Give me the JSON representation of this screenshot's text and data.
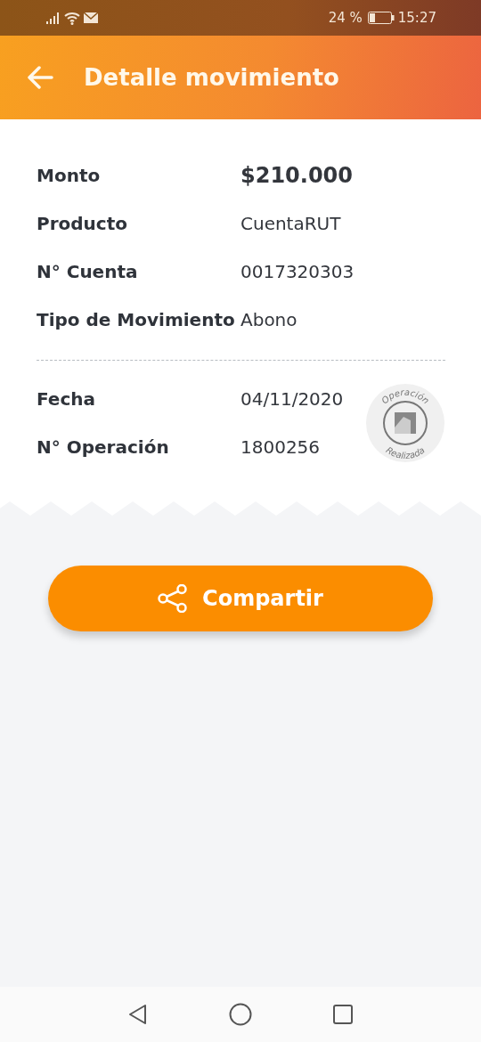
{
  "status_bar": {
    "battery": "24 %",
    "time": "15:27"
  },
  "header": {
    "title": "Detalle movimiento"
  },
  "details": [
    {
      "label": "Monto",
      "value": "$210.000",
      "kind": "amount"
    },
    {
      "label": "Producto",
      "value": "CuentaRUT",
      "kind": "plain"
    },
    {
      "label": "N° Cuenta",
      "value": "0017320303",
      "kind": "plain"
    },
    {
      "label": "Tipo de Movimiento",
      "value": "Abono",
      "kind": "plain"
    }
  ],
  "operation": [
    {
      "label": "Fecha",
      "value": "04/11/2020"
    },
    {
      "label": "N° Operación",
      "value": "1800256"
    }
  ],
  "stamp": {
    "top": "Operación",
    "bottom": "Realizada"
  },
  "share_button": {
    "label": "Compartir"
  }
}
